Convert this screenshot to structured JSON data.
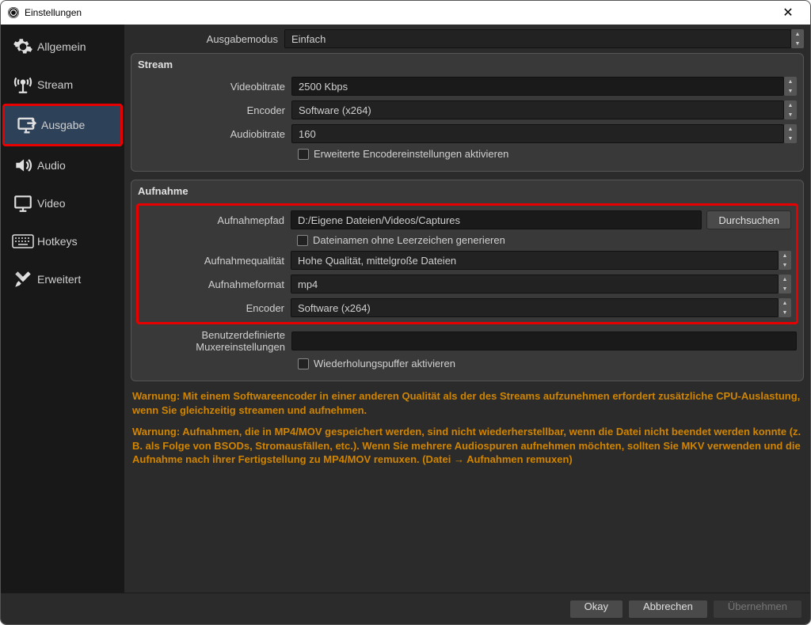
{
  "titlebar": {
    "title": "Einstellungen"
  },
  "sidebar": {
    "items": [
      {
        "label": "Allgemein"
      },
      {
        "label": "Stream"
      },
      {
        "label": "Ausgabe"
      },
      {
        "label": "Audio"
      },
      {
        "label": "Video"
      },
      {
        "label": "Hotkeys"
      },
      {
        "label": "Erweitert"
      }
    ]
  },
  "main": {
    "outputmode_label": "Ausgabemodus",
    "outputmode_value": "Einfach",
    "stream": {
      "title": "Stream",
      "videobitrate_label": "Videobitrate",
      "videobitrate_value": "2500 Kbps",
      "encoder_label": "Encoder",
      "encoder_value": "Software (x264)",
      "audiobitrate_label": "Audiobitrate",
      "audiobitrate_value": "160",
      "advanced_checkbox": "Erweiterte Encodereinstellungen aktivieren"
    },
    "recording": {
      "title": "Aufnahme",
      "path_label": "Aufnahmepfad",
      "path_value": "D:/Eigene Dateien/Videos/Captures",
      "browse_btn": "Durchsuchen",
      "nospace_checkbox": "Dateinamen ohne Leerzeichen generieren",
      "quality_label": "Aufnahmequalität",
      "quality_value": "Hohe Qualität, mittelgroße Dateien",
      "format_label": "Aufnahmeformat",
      "format_value": "mp4",
      "encoder_label": "Encoder",
      "encoder_value": "Software (x264)",
      "muxer_label": "Benutzerdefinierte Muxereinstellungen",
      "muxer_value": "",
      "replay_checkbox": "Wiederholungspuffer aktivieren"
    },
    "warning1": "Warnung: Mit einem Softwareencoder in einer anderen Qualität als der des Streams aufzunehmen erfordert zusätzliche CPU-Auslastung, wenn Sie gleichzeitig streamen und aufnehmen.",
    "warning2": "Warnung: Aufnahmen, die in MP4/MOV gespeichert werden, sind nicht wiederherstellbar, wenn die Datei nicht beendet werden konnte (z. B. als Folge von BSODs, Stromausfällen, etc.). Wenn Sie mehrere Audiospuren aufnehmen möchten, sollten Sie MKV verwenden und die Aufnahme nach ihrer Fertigstellung zu MP4/MOV remuxen. (Datei → Aufnahmen remuxen)"
  },
  "footer": {
    "ok": "Okay",
    "cancel": "Abbrechen",
    "apply": "Übernehmen"
  }
}
